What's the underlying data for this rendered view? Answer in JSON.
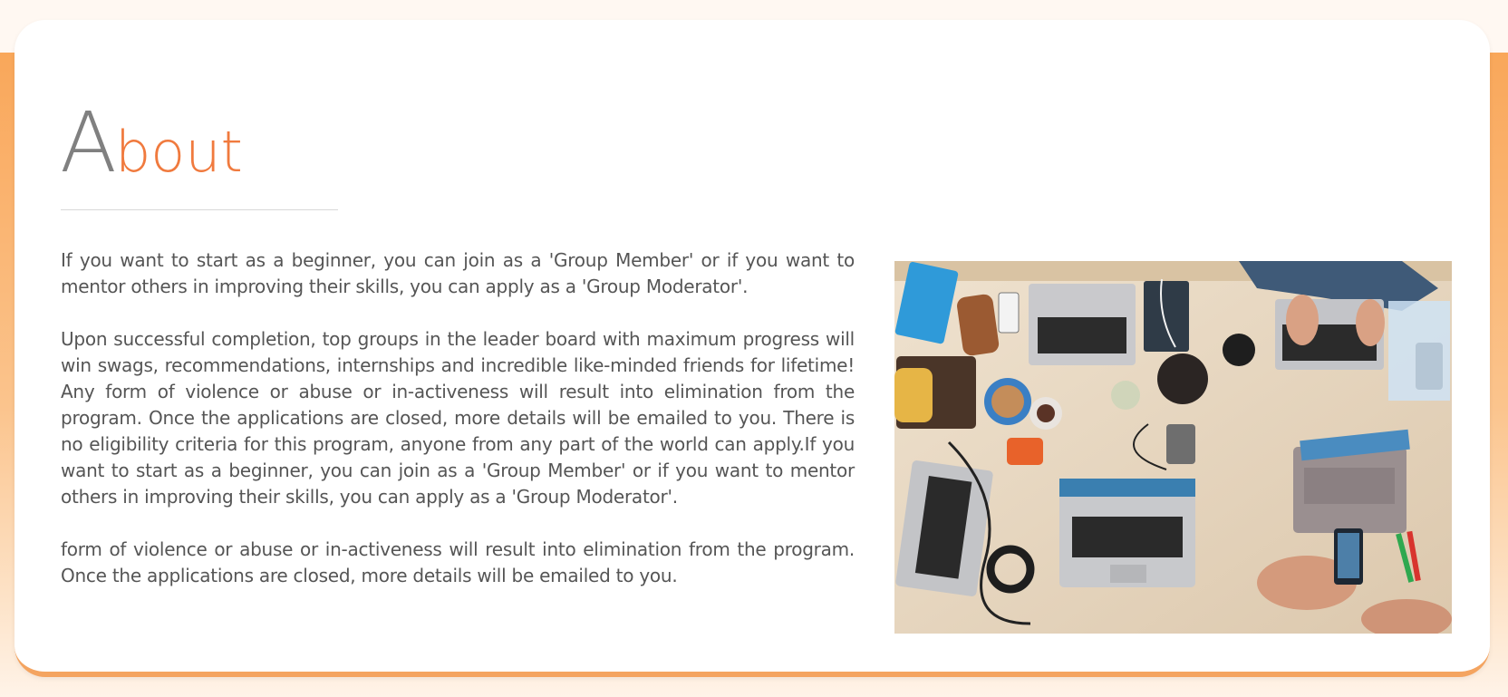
{
  "about": {
    "title_first_letter": "A",
    "title_rest": "bout",
    "paragraphs": [
      "If you want to start as a beginner, you can join as a 'Group Member' or if you want to mentor others in improving their skills, you can apply as a 'Group Moderator'.",
      "Upon successful completion, top groups in the leader board with maximum progress will win swags, recommendations, internships and incredible like-minded friends for lifetime! Any form of violence or abuse or in-activeness will result into elimination from the program. Once the applications are closed, more details will be emailed to you. There is no eligibility criteria for this program, anyone from any part of the world can apply.If you want to start as a beginner, you can join as a 'Group Member' or if you want to mentor others in improving their skills, you can apply as a 'Group Moderator'.",
      "form of violence or abuse or in-activeness will result into elimination from the program. Once the applications are closed, more details will be emailed to you."
    ]
  },
  "colors": {
    "accent": "#f07a3e",
    "title_gray": "#808080",
    "band_orange": "#f9a75a"
  }
}
